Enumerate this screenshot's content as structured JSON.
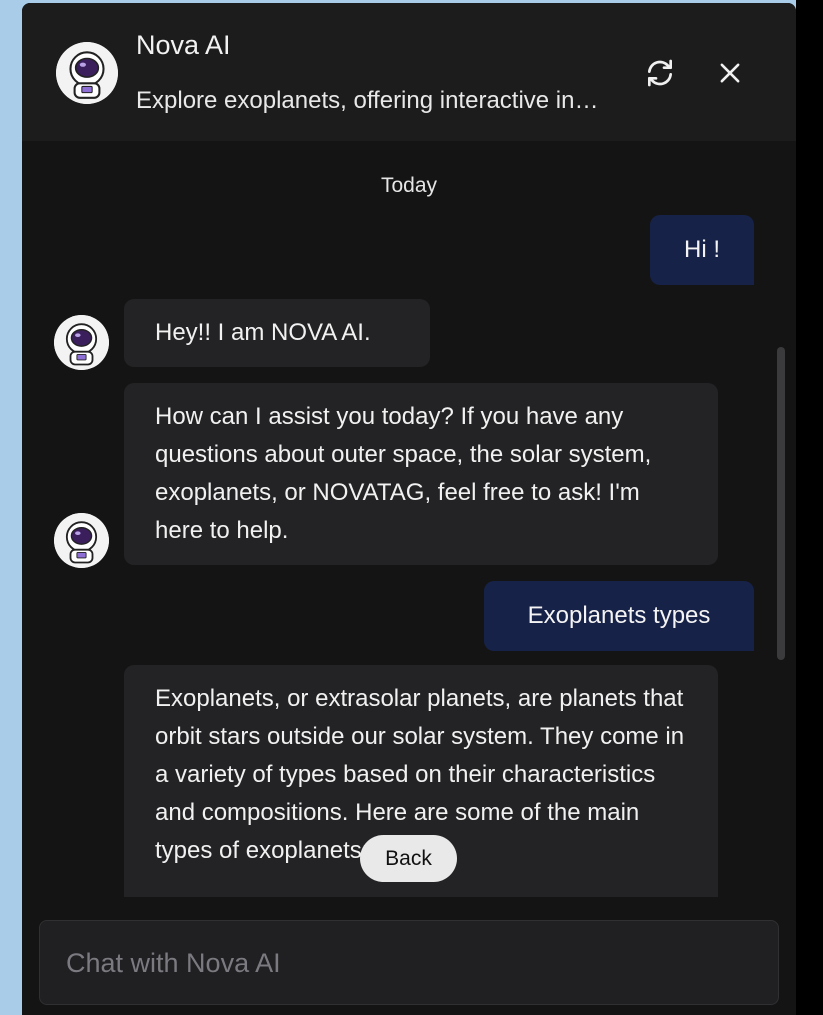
{
  "header": {
    "title": "Nova AI",
    "subtitle": "Explore exoplanets, offering interactive insights about space",
    "refresh_icon": "refresh-icon",
    "close_icon": "close-icon"
  },
  "chat": {
    "date_label": "Today",
    "messages": [
      {
        "role": "user",
        "text": "Hi !"
      },
      {
        "role": "bot",
        "text": "Hey!! I am NOVA AI."
      },
      {
        "role": "bot",
        "text": "How can I assist you today? If you have any questions about outer space, the solar system, exoplanets, or NOVATAG, feel free to ask! I'm here to help."
      },
      {
        "role": "user",
        "text": "Exoplanets types"
      },
      {
        "role": "bot",
        "text": "Exoplanets, or extrasolar planets, are planets that orbit stars outside our solar system. They come in a variety of types based on their characteristics and compositions. Here are some of the main types of exoplanets:"
      }
    ]
  },
  "back_button": {
    "label": "Back"
  },
  "input": {
    "placeholder": "Chat with Nova AI",
    "value": ""
  },
  "colors": {
    "page_bg": "#a9cce9",
    "panel_bg": "#141414",
    "header_bg": "#1c1c1c",
    "user_bubble": "#172248",
    "bot_bubble": "#232325"
  }
}
